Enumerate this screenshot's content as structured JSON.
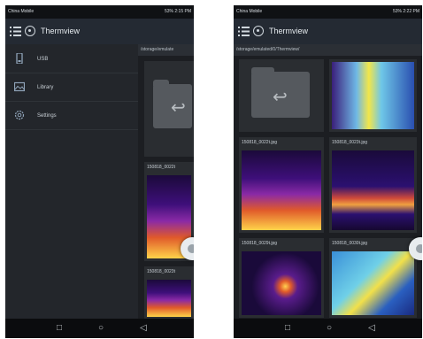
{
  "left_screen": {
    "statusbar": {
      "carrier": "China Mobile",
      "status": "53% 2:15 PM"
    },
    "appbar": {
      "title": "Thermview"
    },
    "path": "/storage/emulate",
    "drawer": {
      "items": [
        {
          "label": "USB",
          "icon": "usb-icon"
        },
        {
          "label": "Library",
          "icon": "library-icon"
        },
        {
          "label": "Settings",
          "icon": "settings-gear-icon"
        }
      ]
    },
    "tiles": [
      {
        "caption": ""
      },
      {
        "caption": "150818_0022t"
      },
      {
        "caption": "150818_0023t"
      }
    ]
  },
  "right_screen": {
    "statusbar": {
      "carrier": "China Mobile",
      "status": "53% 2:22 PM"
    },
    "appbar": {
      "title": "Thermview"
    },
    "path": "/storage/emulated/0/Thermview/",
    "tiles": [
      {
        "caption": ""
      },
      {
        "caption": ""
      },
      {
        "caption": "150818_0022t.jpg"
      },
      {
        "caption": "150818_0023t.jpg"
      },
      {
        "caption": "150818_0029t.jpg"
      },
      {
        "caption": "150818_0030t.jpg"
      }
    ]
  },
  "colors": {
    "appbar": "#242a33",
    "background": "#1c1e22",
    "accent": "#e05a2a"
  }
}
